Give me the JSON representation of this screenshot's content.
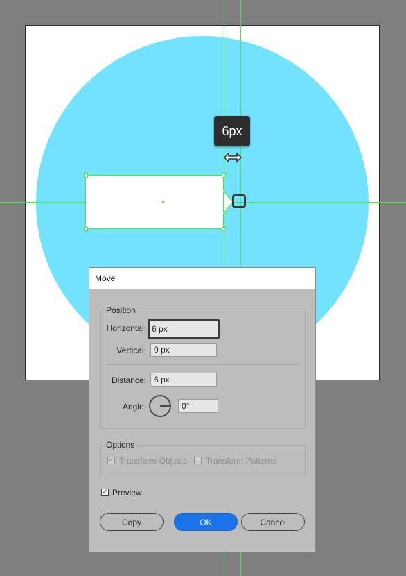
{
  "colors": {
    "background": "#7f7f7f",
    "circle": "#73e2ff",
    "guide": "#4fe34f",
    "primary_button": "#1a73e8"
  },
  "canvas": {
    "tooltip_text": "6px",
    "cursor_icon": "move-horizontal-arrows-icon"
  },
  "dialog": {
    "title": "Move",
    "position_legend": "Position",
    "horizontal_label": "Horizontal:",
    "horizontal_value": "6 px",
    "vertical_label": "Vertical:",
    "vertical_value": "0 px",
    "distance_label": "Distance:",
    "distance_value": "6 px",
    "angle_label": "Angle:",
    "angle_value": "0°",
    "options_legend": "Options",
    "transform_objects": "Transform Objects",
    "transform_patterns": "Transform Patterns",
    "preview": "Preview",
    "copy": "Copy",
    "ok": "OK",
    "cancel": "Cancel"
  }
}
